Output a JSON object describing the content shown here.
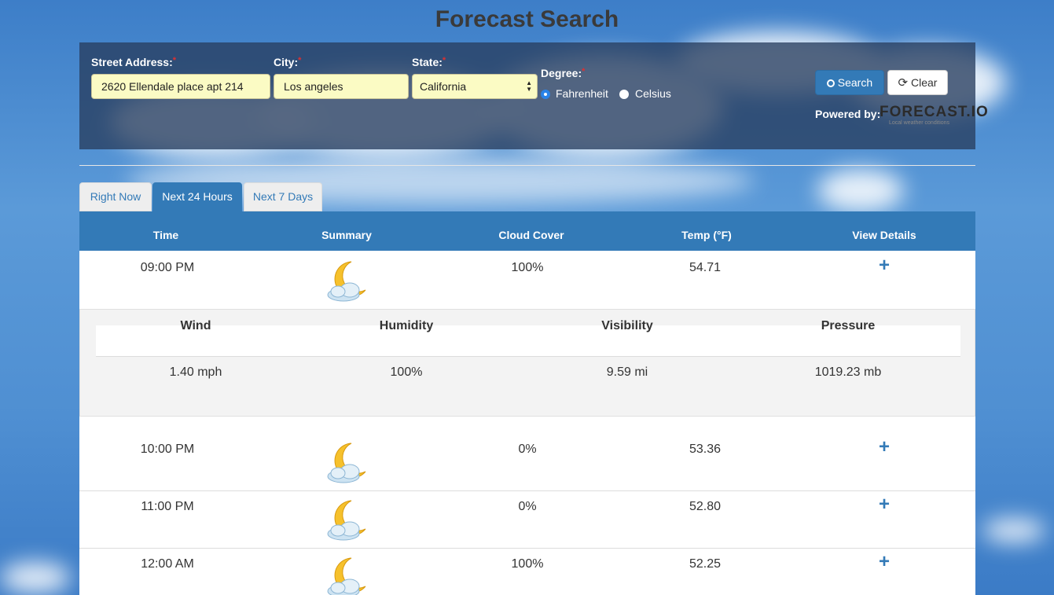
{
  "page": {
    "title": "Forecast Search"
  },
  "form": {
    "street_label": "Street Address:",
    "street_value": "2620 Ellendale place apt 214",
    "city_label": "City:",
    "city_value": "Los angeles",
    "state_label": "State:",
    "state_value": "California",
    "degree_label": "Degree:",
    "required_mark": "*",
    "degree_options": [
      "Fahrenheit",
      "Celsius"
    ],
    "degree_selected": "Fahrenheit",
    "search_label": "Search",
    "clear_label": "Clear",
    "powered_by": "Powered by:",
    "logo_text": "FORECAST.IO",
    "logo_tagline": "Local weather conditions"
  },
  "tabs": [
    {
      "label": "Right Now",
      "active": false
    },
    {
      "label": "Next 24 Hours",
      "active": true
    },
    {
      "label": "Next 7 Days",
      "active": false
    }
  ],
  "table": {
    "headers": [
      "Time",
      "Summary",
      "Cloud Cover",
      "Temp (°F)",
      "View Details"
    ],
    "rows": [
      {
        "time": "09:00 PM",
        "icon": "cloudy-night-icon",
        "cloud": "100%",
        "temp": "54.71"
      },
      {
        "time": "10:00 PM",
        "icon": "clear-night-icon",
        "cloud": "0%",
        "temp": "53.36"
      },
      {
        "time": "11:00 PM",
        "icon": "clear-night-icon",
        "cloud": "0%",
        "temp": "52.80"
      },
      {
        "time": "12:00 AM",
        "icon": "cloudy-night-icon",
        "cloud": "100%",
        "temp": "52.25"
      }
    ],
    "expand_icon": "plus-icon"
  },
  "details": {
    "headers": [
      "Wind",
      "Humidity",
      "Visibility",
      "Pressure"
    ],
    "values": [
      "1.40 mph",
      "100%",
      "9.59 mi",
      "1019.23 mb"
    ]
  },
  "colors": {
    "accent": "#337ab7",
    "required": "#e03030",
    "input_bg": "#fbfbc4"
  }
}
